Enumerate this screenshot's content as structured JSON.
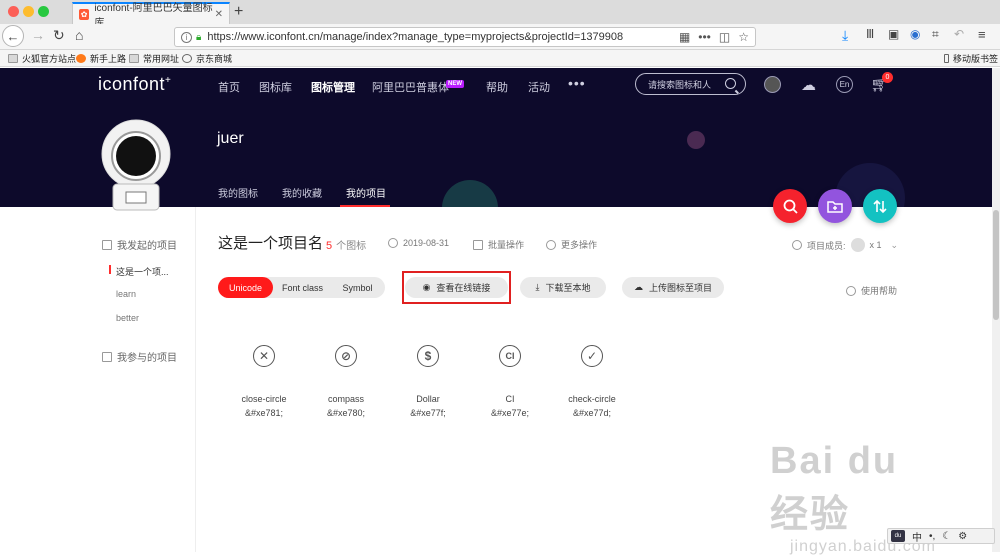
{
  "browser": {
    "tab_title": "iconfont-阿里巴巴矢量图标库",
    "tab_favicon": "icon",
    "url": "https://www.iconfont.cn/manage/index?manage_type=myprojects&projectId=1379908",
    "bookmarks": [
      "火狐官方站点",
      "新手上路",
      "常用网址",
      "京东商城"
    ],
    "mobile_bookmarks": "移动版书签"
  },
  "site": {
    "logo": "iconfont",
    "logo_mark": "+",
    "nav": [
      "首页",
      "图标库",
      "图标管理",
      "阿里巴巴普惠体",
      "帮助",
      "活动"
    ],
    "new_badge": "NEW",
    "more": "•••",
    "search_placeholder": "请搜索图标和人",
    "lang": "En",
    "cart_count": "0"
  },
  "profile": {
    "username": "juer",
    "tabs": [
      "我的图标",
      "我的收藏",
      "我的项目"
    ]
  },
  "sidebar": {
    "group1": "我发起的项目",
    "items": [
      "这是一个项...",
      "learn",
      "better"
    ],
    "group2": "我参与的项目"
  },
  "project": {
    "title": "这是一个项目名",
    "count": "5",
    "count_unit": "个图标",
    "date": "2019-08-31",
    "batch": "批量操作",
    "more_ops": "更多操作",
    "members_label": "项目成员:",
    "members_count": "x 1",
    "help": "使用帮助"
  },
  "toolbar": {
    "formats": [
      "Unicode",
      "Font class",
      "Symbol"
    ],
    "view_online": "查看在线链接",
    "download": "下载至本地",
    "upload": "上传图标至项目"
  },
  "icons": [
    {
      "name": "close-circle",
      "code": "&#xe781;",
      "glyph": "✕"
    },
    {
      "name": "compass",
      "code": "&#xe780;",
      "glyph": "⊘"
    },
    {
      "name": "Dollar",
      "code": "&#xe77f;",
      "glyph": "$"
    },
    {
      "name": "CI",
      "code": "&#xe77e;",
      "glyph": "CI"
    },
    {
      "name": "check-circle",
      "code": "&#xe77d;",
      "glyph": "✓"
    }
  ],
  "watermark": {
    "main": "Bai du 经验",
    "sub": "jingyan.baidu.com"
  },
  "ime": {
    "du": "du",
    "zh": "中",
    "dot": "•,",
    "moon": "☾",
    "gear": "⚙"
  },
  "colors": {
    "accent": "#ff1a1a",
    "header_bg": "#0d0a2b",
    "fab_red": "#f5222d",
    "fab_purple": "#9254de",
    "fab_teal": "#13c2c2"
  }
}
